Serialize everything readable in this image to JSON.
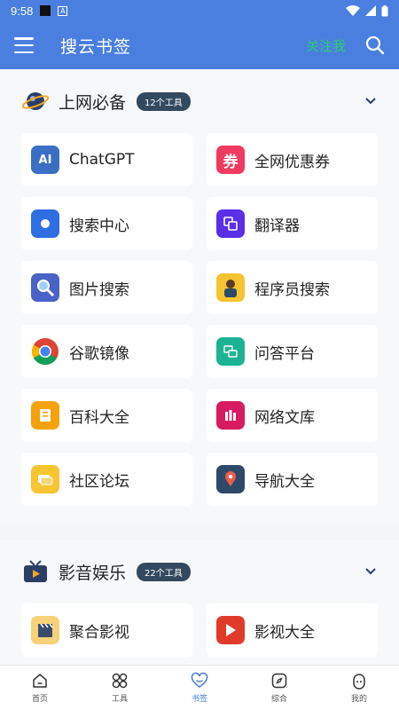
{
  "status": {
    "time": "9:58"
  },
  "header": {
    "title": "搜云书签",
    "follow_label": "关注我"
  },
  "sections": [
    {
      "title": "上网必备",
      "badge": "12个工具",
      "items": [
        {
          "label": "ChatGPT",
          "icon": "ai-chip-icon",
          "color": "#3b6fc4"
        },
        {
          "label": "全网优惠券",
          "icon": "coupon-icon",
          "color": "#f03a5f"
        },
        {
          "label": "搜索中心",
          "icon": "search-dot-icon",
          "color": "#2f6de3"
        },
        {
          "label": "翻译器",
          "icon": "translate-icon",
          "color": "#5b2ee8"
        },
        {
          "label": "图片搜索",
          "icon": "magnifier-icon",
          "color": "#4a63c8"
        },
        {
          "label": "程序员搜索",
          "icon": "programmer-icon",
          "color": "#f5c431"
        },
        {
          "label": "谷歌镜像",
          "icon": "chrome-icon",
          "color": "#dd4b39"
        },
        {
          "label": "问答平台",
          "icon": "qa-icon",
          "color": "#1bb394"
        },
        {
          "label": "百科大全",
          "icon": "encyclopedia-icon",
          "color": "#f5a10a"
        },
        {
          "label": "网络文库",
          "icon": "library-icon",
          "color": "#d81b60"
        },
        {
          "label": "社区论坛",
          "icon": "forum-icon",
          "color": "#f7c531"
        },
        {
          "label": "导航大全",
          "icon": "map-pin-icon",
          "color": "#2e4a68"
        }
      ]
    },
    {
      "title": "影音娱乐",
      "badge": "22个工具",
      "items": [
        {
          "label": "聚合影视",
          "icon": "clapper-icon",
          "color": "#f6d27a"
        },
        {
          "label": "影视大全",
          "icon": "play-icon",
          "color": "#e03b2a"
        }
      ]
    }
  ],
  "nav": [
    {
      "label": "首页",
      "icon": "home-icon",
      "active": false
    },
    {
      "label": "工具",
      "icon": "tools-icon",
      "active": false
    },
    {
      "label": "书签",
      "icon": "heart-icon",
      "active": true
    },
    {
      "label": "综合",
      "icon": "compass-icon",
      "active": false
    },
    {
      "label": "我的",
      "icon": "profile-icon",
      "active": false
    }
  ],
  "colors": {
    "primary": "#4a7fe0",
    "follow": "#2ecc71",
    "badge": "#33495f"
  }
}
